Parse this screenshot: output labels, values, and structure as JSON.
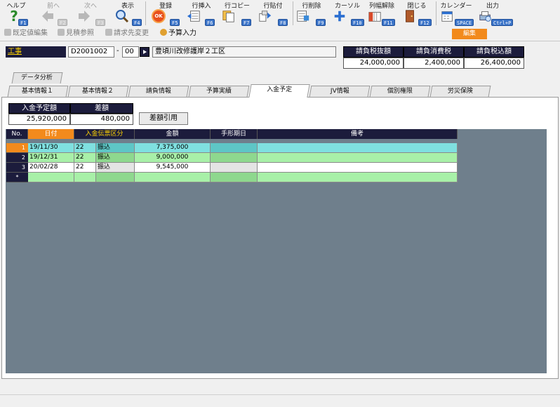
{
  "toolbar": {
    "buttons": [
      {
        "label": "ヘルプ",
        "key": "F1"
      },
      {
        "label": "前へ",
        "key": "F2"
      },
      {
        "label": "次へ",
        "key": "F3"
      },
      {
        "label": "表示",
        "key": "F4"
      },
      {
        "label": "登録",
        "key": "F5"
      },
      {
        "label": "行挿入",
        "key": "F6"
      },
      {
        "label": "行コピー",
        "key": "F7"
      },
      {
        "label": "行貼付",
        "key": "F8"
      },
      {
        "label": "行削除",
        "key": "F9"
      },
      {
        "label": "カーソル",
        "key": "F10"
      },
      {
        "label": "列幅解除",
        "key": "F11"
      },
      {
        "label": "閉じる",
        "key": "F12"
      },
      {
        "label": "カレンダー",
        "key": "SPACE"
      },
      {
        "label": "出力",
        "key": "Ctrl+P"
      }
    ],
    "ok_icon_text": "OK"
  },
  "subbar": {
    "fixed_edit": "既定値編集",
    "estimate_ref": "見積参照",
    "billing_change": "請求先変更",
    "budget_input": "予算入力",
    "edit_badge": "編集"
  },
  "project": {
    "label": "工事",
    "code": "D2001002",
    "dash": "-",
    "sub_code": "00",
    "name": "豊頃川改修護岸２工区"
  },
  "contract": {
    "headers": [
      "請負税抜額",
      "請負消費税",
      "請負税込額"
    ],
    "values": [
      "24,000,000",
      "2,400,000",
      "26,400,000"
    ]
  },
  "data_tab": "データ分析",
  "tabs": [
    "基本情報１",
    "基本情報２",
    "請負情報",
    "予算実績",
    "入金予定",
    "JV情報",
    "個別権限",
    "労災保険"
  ],
  "summary": {
    "headers": [
      "入金予定額",
      "差額"
    ],
    "values": [
      "25,920,000",
      "480,000"
    ],
    "quote_button": "差額引用"
  },
  "grid": {
    "headers": [
      "No.",
      "日付",
      "入金伝票区分",
      "",
      "金額",
      "手形期日",
      "備考"
    ],
    "rows": [
      {
        "no": "1",
        "date": "19/11/30",
        "code": "22",
        "kind": "振込",
        "amount": "7,375,000",
        "due": "",
        "note": ""
      },
      {
        "no": "2",
        "date": "19/12/31",
        "code": "22",
        "kind": "振込",
        "amount": "9,000,000",
        "due": "",
        "note": ""
      },
      {
        "no": "3",
        "date": "20/02/28",
        "code": "22",
        "kind": "振込",
        "amount": "9,545,000",
        "due": "",
        "note": ""
      }
    ],
    "new_row_marker": "*"
  },
  "colors": {
    "header_bg": "#1c1c3c",
    "accent_orange": "#f28a1c",
    "selected_row": "#7fe0e0",
    "row_green": "#a8f0a8",
    "grid_area": "#6f7f8c"
  }
}
